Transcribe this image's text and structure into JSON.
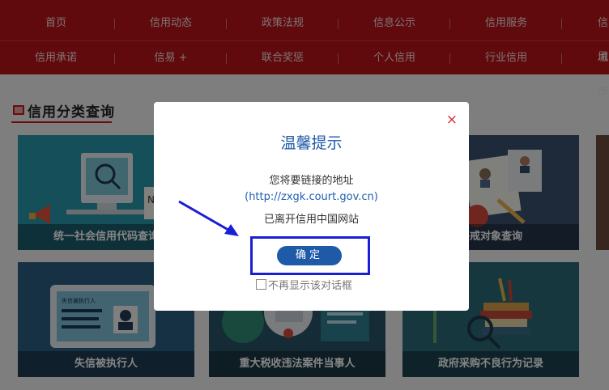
{
  "nav": {
    "row1": [
      "首页",
      "信用动态",
      "政策法规",
      "信息公示",
      "信用服务",
      "信用"
    ],
    "row2": [
      "信用承诺",
      "信易 +",
      "联合奖惩",
      "个人信用",
      "行业信用",
      "城市"
    ]
  },
  "section": {
    "title": "信用分类查询"
  },
  "cards": [
    "统一社会信用代码查询",
    "惩戒对象查询",
    "失信被执行人",
    "重大税收违法案件当事人",
    "政府采购不良行为记录"
  ],
  "card_texts": {
    "badge_label": "失信被执行人"
  },
  "modal": {
    "title": "温馨提示",
    "line1": "您将要链接的地址",
    "url": "(http://zxgk.court.gov.cn)",
    "line3": "已离开信用中国网站",
    "confirm": "确定",
    "dont_show": "不再显示该对话框",
    "close": "×"
  },
  "colors": {
    "nav": "#b8141a",
    "accent": "#1e5aa8",
    "highlight": "#1a1fd6"
  }
}
